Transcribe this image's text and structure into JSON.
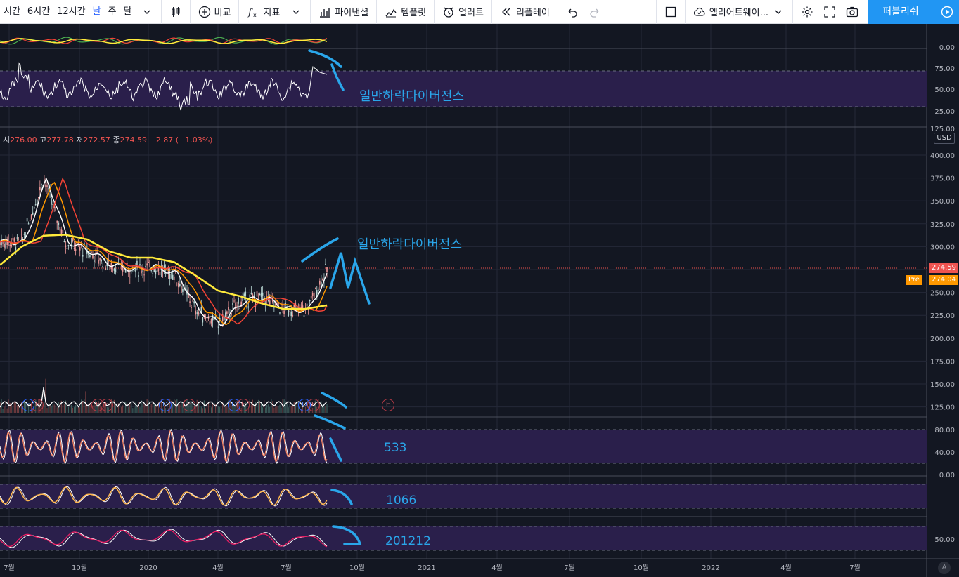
{
  "toolbar": {
    "intervals": [
      "시간",
      "6시간",
      "12시간",
      "날",
      "주",
      "달"
    ],
    "active_interval": "날",
    "buttons": {
      "compare": "비교",
      "indicators": "지표",
      "financials": "파이낸셜",
      "templates": "템플릿",
      "alerts": "얼러트",
      "replay": "리플레이",
      "layout_name": "엘리어트웨이...",
      "publish": "퍼블리쉬"
    }
  },
  "legend": {
    "open_label": "시",
    "open": "276.00",
    "high_label": "고",
    "high": "277.78",
    "low_label": "저",
    "low": "272.57",
    "close_label": "종",
    "close": "274.59",
    "change": "−2.87 (−1.03%)"
  },
  "price_axis": {
    "unit": "USD",
    "labels": [
      "400.00",
      "375.00",
      "350.00",
      "325.00",
      "300.00",
      "275.00",
      "250.00",
      "225.00",
      "200.00",
      "175.00",
      "150.00",
      "125.00"
    ],
    "last_price": "274.59",
    "pre_label": "Pre",
    "pre_price": "274.04"
  },
  "rsi_axis": {
    "labels": [
      "75.00",
      "50.00",
      "25.00"
    ],
    "top": "0.00",
    "partial": "125.00"
  },
  "stoch1_axis": {
    "labels": [
      "80.00",
      "40.00",
      "0.00"
    ]
  },
  "stoch3_axis": {
    "labels": [
      "50.00"
    ]
  },
  "time_axis": {
    "labels": [
      "7월",
      "10월",
      "2020",
      "4월",
      "7월",
      "10월",
      "2021",
      "4월",
      "7월",
      "10월",
      "2022",
      "4월",
      "7월"
    ]
  },
  "annotations": {
    "rsi_divergence": "일반하락다이버전스",
    "price_divergence": "일반하락다이버전스",
    "stoch_533": "533",
    "stoch_1066": "1066",
    "stoch_201212": "201212"
  },
  "events": [
    "E",
    "E",
    "E",
    "D",
    "E",
    "D",
    "E",
    "E",
    "D",
    "E",
    "E"
  ],
  "auto_scale": "A",
  "colors": {
    "bg": "#131722",
    "accent": "#2196f3",
    "down": "#ef5350",
    "ma_white": "#ffffff",
    "ma_orange": "#ff9800",
    "ma_red": "#f44336",
    "ma_yellow": "#ffeb3b",
    "band": "#2a1f4b",
    "annotation": "#2aa6ea"
  },
  "chart_data": {
    "type": "candlestick",
    "price_series": {
      "x": [
        "2019-06",
        "2019-07",
        "2019-08",
        "2019-09",
        "2019-10",
        "2019-11",
        "2019-12",
        "2020-01",
        "2020-02",
        "2020-03",
        "2020-04",
        "2020-05",
        "2020-06",
        "2020-07",
        "2020-08",
        "2020-09"
      ],
      "close": [
        305,
        305,
        375,
        305,
        295,
        280,
        275,
        278,
        270,
        230,
        215,
        240,
        245,
        232,
        230,
        275
      ]
    },
    "ma_long_yellow": [
      280,
      300,
      312,
      313,
      308,
      295,
      288,
      288,
      283,
      268,
      252,
      246,
      238,
      232,
      232,
      236
    ],
    "last_close": 274.59,
    "ylim": [
      115,
      420
    ]
  }
}
